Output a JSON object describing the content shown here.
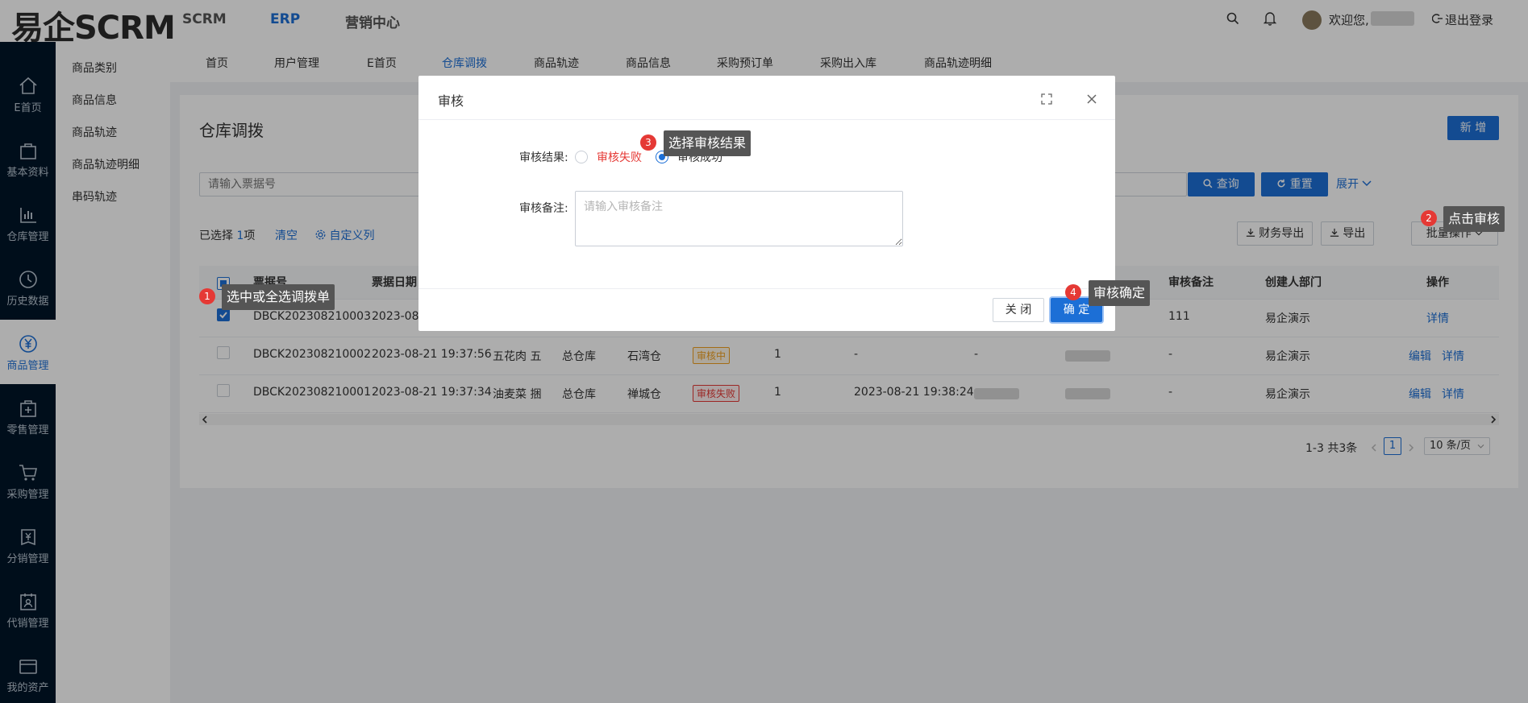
{
  "header": {
    "logo": "易企SCRM",
    "nav": [
      "SCRM",
      "ERP",
      "营销中心"
    ],
    "welcome": "欢迎您,",
    "logout": "退出登录"
  },
  "sidebar": {
    "items": [
      {
        "label": "E首页",
        "icon": "home-icon"
      },
      {
        "label": "基本资料",
        "icon": "bag-icon"
      },
      {
        "label": "仓库管理",
        "icon": "bar-chart-icon"
      },
      {
        "label": "历史数据",
        "icon": "clock-icon"
      },
      {
        "label": "商品管理",
        "icon": "yen-circle-icon"
      },
      {
        "label": "零售管理",
        "icon": "box-plus-icon"
      },
      {
        "label": "采购管理",
        "icon": "cart-icon"
      },
      {
        "label": "分销管理",
        "icon": "yen-box-icon"
      },
      {
        "label": "代销管理",
        "icon": "calendar-user-icon"
      },
      {
        "label": "我的资产",
        "icon": "wallet-icon"
      }
    ]
  },
  "subsidebar": {
    "items": [
      "商品类别",
      "商品信息",
      "商品轨迹",
      "商品轨迹明细",
      "串码轨迹"
    ]
  },
  "tabs": [
    "首页",
    "用户管理",
    "E首页",
    "仓库调拨",
    "商品轨迹",
    "商品信息",
    "采购预订单",
    "采购出入库",
    "商品轨迹明细"
  ],
  "page": {
    "title": "仓库调拨",
    "new_button": "新 增",
    "search_placeholder": "请输入票据号",
    "query": "查询",
    "reset": "重置",
    "expand": "展开",
    "selected_prefix": "已选择",
    "selected_count": "1",
    "selected_suffix": "项",
    "clear": "清空",
    "custom_columns": "自定义列",
    "finance_export": "财务导出",
    "export": "导出",
    "batch": "批量操作"
  },
  "table": {
    "headers": [
      "票据号",
      "票据日期",
      "审核备注",
      "创建人部门",
      "操作"
    ],
    "rows": [
      {
        "no": "DBCK202308210003",
        "date": "2023-08-",
        "remark": "111",
        "dept": "易企演示",
        "actions": [
          "详情"
        ]
      },
      {
        "no": "DBCK202308210002",
        "date": "2023-08-21 19:37:56",
        "goods": "五花肉 五",
        "from": "总仓库",
        "to": "石湾仓",
        "status": "审核中",
        "qty": "1",
        "audit_time": "-",
        "auditor": "-",
        "remark": "-",
        "dept": "易企演示",
        "actions": [
          "编辑",
          "详情"
        ]
      },
      {
        "no": "DBCK202308210001",
        "date": "2023-08-21 19:37:34",
        "goods": "油麦菜 捆",
        "from": "总仓库",
        "to": "禅城仓",
        "status": "审核失败",
        "qty": "1",
        "audit_time": "2023-08-21 19:38:24",
        "remark": "-",
        "dept": "易企演示",
        "actions": [
          "编辑",
          "详情"
        ]
      }
    ]
  },
  "pagination": {
    "summary": "1-3 共3条",
    "page": "1",
    "size": "10 条/页"
  },
  "modal": {
    "title": "审核",
    "result_label": "审核结果:",
    "option_fail": "审核失败",
    "option_success": "审核成功",
    "remark_label": "审核备注:",
    "remark_placeholder": "请输入审核备注",
    "close": "关 闭",
    "confirm": "确 定"
  },
  "tips": [
    {
      "num": "1",
      "text": "选中或全选调拨单"
    },
    {
      "num": "2",
      "text": "点击审核"
    },
    {
      "num": "3",
      "text": "选择审核结果"
    },
    {
      "num": "4",
      "text": "审核确定"
    }
  ],
  "colors": {
    "primary": "#1c6fd6",
    "sidebar": "#001529",
    "danger": "#e53935",
    "warning": "#f0a020"
  }
}
